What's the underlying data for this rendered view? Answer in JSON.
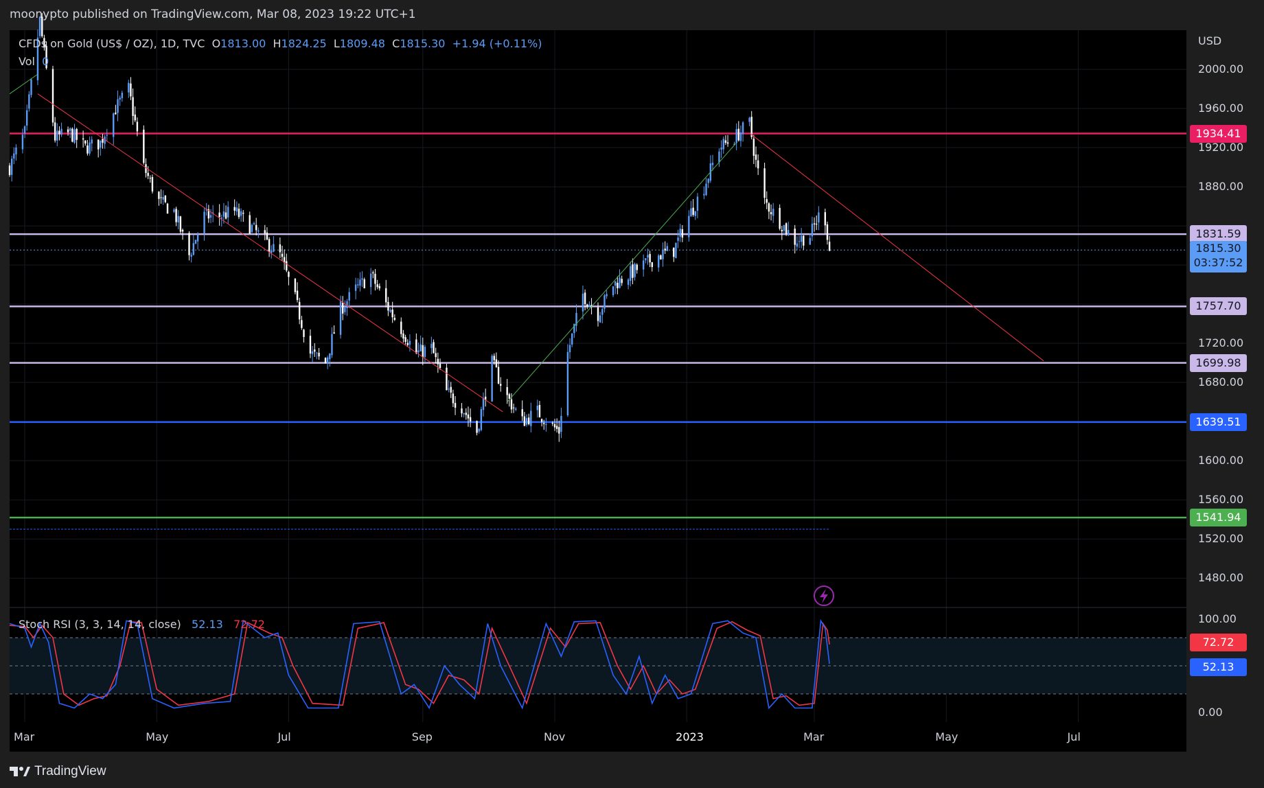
{
  "header": {
    "published_by": "moonypto published on TradingView.com, Mar 08, 2023 19:22 UTC+1"
  },
  "legend": {
    "symbol": "CFDs on Gold (US$ / OZ), 1D, TVC",
    "open_label": "O",
    "open": "1813.00",
    "high_label": "H",
    "high": "1824.25",
    "low_label": "L",
    "low": "1809.48",
    "close_label": "C",
    "close": "1815.30",
    "change": "+1.94 (+0.11%)",
    "vol_label": "Vol",
    "vol_value": "0"
  },
  "stoch_legend": {
    "label": "Stoch RSI (3, 3, 14, 14, close)",
    "k": "52.13",
    "d": "72.72"
  },
  "footer": {
    "brand": "TradingView"
  },
  "colors": {
    "background": "#000000",
    "frame": "#1e1e1e",
    "bull": "#5b9cf6",
    "bear": "#ffffff",
    "red_line": "#f23645",
    "resist_magenta": "#e91e63",
    "lavender": "#c9b8e8",
    "blue_support": "#2962ff",
    "green_support": "#4caf50",
    "stoch_k": "#2962ff",
    "stoch_d": "#f23645"
  },
  "chart_data": [
    {
      "type": "candlestick",
      "title": "CFDs on Gold (US$ / OZ), 1D, TVC",
      "currency": "USD",
      "ylim": [
        1450,
        2040
      ],
      "yticks": [
        2000,
        1960,
        1920,
        1880,
        1840,
        1800,
        1760,
        1720,
        1680,
        1640,
        1600,
        1560,
        1520,
        1480
      ],
      "ytick_labels": [
        "2000.00",
        "1960.00",
        "1920.00",
        "1880.00",
        "",
        "",
        "",
        "1720.00",
        "1680.00",
        "",
        "1600.00",
        "1560.00",
        "1520.00",
        "1480.00"
      ],
      "x_labels": [
        "Mar",
        "May",
        "Jul",
        "Sep",
        "Nov",
        "2023",
        "Mar",
        "May",
        "Jul"
      ],
      "x_label_dates": [
        "2022-03-01",
        "2022-05-01",
        "2022-07-01",
        "2022-09-01",
        "2022-11-01",
        "2023-01-01",
        "2023-03-01",
        "2023-05-01",
        "2023-07-01"
      ],
      "x_range": [
        "2022-02-22",
        "2023-08-20"
      ],
      "last_date": "2023-03-08",
      "close_path": [
        [
          "2022-02-22",
          1900
        ],
        [
          "2022-03-01",
          1935
        ],
        [
          "2022-03-08",
          2050
        ],
        [
          "2022-03-15",
          1930
        ],
        [
          "2022-03-22",
          1935
        ],
        [
          "2022-03-29",
          1920
        ],
        [
          "2022-04-05",
          1925
        ],
        [
          "2022-04-12",
          1960
        ],
        [
          "2022-04-18",
          1980
        ],
        [
          "2022-04-25",
          1900
        ],
        [
          "2022-05-02",
          1865
        ],
        [
          "2022-05-09",
          1855
        ],
        [
          "2022-05-16",
          1810
        ],
        [
          "2022-05-23",
          1850
        ],
        [
          "2022-05-30",
          1850
        ],
        [
          "2022-06-06",
          1855
        ],
        [
          "2022-06-13",
          1840
        ],
        [
          "2022-06-20",
          1825
        ],
        [
          "2022-06-27",
          1810
        ],
        [
          "2022-07-04",
          1765
        ],
        [
          "2022-07-11",
          1710
        ],
        [
          "2022-07-18",
          1700
        ],
        [
          "2022-07-25",
          1755
        ],
        [
          "2022-08-01",
          1775
        ],
        [
          "2022-08-08",
          1790
        ],
        [
          "2022-08-15",
          1760
        ],
        [
          "2022-08-22",
          1735
        ],
        [
          "2022-08-29",
          1710
        ],
        [
          "2022-09-05",
          1715
        ],
        [
          "2022-09-12",
          1670
        ],
        [
          "2022-09-19",
          1655
        ],
        [
          "2022-09-26",
          1630
        ],
        [
          "2022-10-03",
          1700
        ],
        [
          "2022-10-10",
          1665
        ],
        [
          "2022-10-17",
          1640
        ],
        [
          "2022-10-24",
          1650
        ],
        [
          "2022-10-31",
          1635
        ],
        [
          "2022-11-03",
          1630
        ],
        [
          "2022-11-07",
          1710
        ],
        [
          "2022-11-14",
          1770
        ],
        [
          "2022-11-21",
          1750
        ],
        [
          "2022-11-28",
          1780
        ],
        [
          "2022-12-05",
          1790
        ],
        [
          "2022-12-12",
          1800
        ],
        [
          "2022-12-19",
          1810
        ],
        [
          "2022-12-26",
          1815
        ],
        [
          "2023-01-02",
          1850
        ],
        [
          "2023-01-09",
          1880
        ],
        [
          "2023-01-16",
          1920
        ],
        [
          "2023-01-23",
          1930
        ],
        [
          "2023-01-30",
          1945
        ],
        [
          "2023-02-02",
          1905
        ],
        [
          "2023-02-06",
          1865
        ],
        [
          "2023-02-13",
          1845
        ],
        [
          "2023-02-20",
          1825
        ],
        [
          "2023-02-27",
          1830
        ],
        [
          "2023-03-03",
          1850
        ],
        [
          "2023-03-06",
          1847
        ],
        [
          "2023-03-08",
          1815.3
        ]
      ],
      "levels": [
        {
          "value": 1934.41,
          "label": "1934.41",
          "color": "#e91e63"
        },
        {
          "value": 1831.59,
          "label": "1831.59",
          "color": "#c9b8e8"
        },
        {
          "value": 1757.7,
          "label": "1757.70",
          "color": "#c9b8e8"
        },
        {
          "value": 1699.98,
          "label": "1699.98",
          "color": "#c9b8e8"
        },
        {
          "value": 1639.51,
          "label": "1639.51",
          "color": "#2962ff"
        },
        {
          "value": 1541.94,
          "label": "1541.94",
          "color": "#4caf50"
        }
      ],
      "last_price": {
        "value": 1815.3,
        "label": "1815.30",
        "countdown": "03:37:52",
        "color": "#5b9cf6"
      },
      "trendlines": [
        {
          "from": [
            "2022-03-07",
            1975
          ],
          "to": [
            "2022-10-08",
            1650
          ],
          "color": "#f23645"
        },
        {
          "from": [
            "2022-10-10",
            1660
          ],
          "to": [
            "2023-01-24",
            1925
          ],
          "color": "#4caf50"
        },
        {
          "from": [
            "2022-02-22",
            1975
          ],
          "to": [
            "2022-03-07",
            1995
          ],
          "color": "#4caf50"
        },
        {
          "from": [
            "2023-01-30",
            1935
          ],
          "to": [
            "2023-06-15",
            1702
          ],
          "color": "#f23645"
        }
      ]
    },
    {
      "type": "line",
      "title": "Stoch RSI (3, 3, 14, 14, close)",
      "ylim": [
        -10,
        110
      ],
      "yticks": [
        100,
        0
      ],
      "ytick_labels": [
        "100.00",
        "0.00"
      ],
      "bands": [
        80,
        50,
        20
      ],
      "series": [
        {
          "name": "K",
          "color": "#2962ff",
          "last": 52.13,
          "label": "52.13"
        },
        {
          "name": "D",
          "color": "#f23645",
          "last": 72.72,
          "label": "72.72"
        }
      ],
      "k_path": [
        [
          "2022-02-22",
          95
        ],
        [
          "2022-03-01",
          90
        ],
        [
          "2022-03-04",
          70
        ],
        [
          "2022-03-08",
          95
        ],
        [
          "2022-03-12",
          75
        ],
        [
          "2022-03-17",
          10
        ],
        [
          "2022-03-24",
          5
        ],
        [
          "2022-03-31",
          20
        ],
        [
          "2022-04-06",
          15
        ],
        [
          "2022-04-12",
          30
        ],
        [
          "2022-04-17",
          98
        ],
        [
          "2022-04-22",
          95
        ],
        [
          "2022-04-29",
          15
        ],
        [
          "2022-05-09",
          5
        ],
        [
          "2022-05-23",
          10
        ],
        [
          "2022-06-04",
          12
        ],
        [
          "2022-06-10",
          98
        ],
        [
          "2022-06-20",
          80
        ],
        [
          "2022-06-26",
          85
        ],
        [
          "2022-07-01",
          40
        ],
        [
          "2022-07-10",
          5
        ],
        [
          "2022-07-24",
          5
        ],
        [
          "2022-07-31",
          95
        ],
        [
          "2022-08-12",
          97
        ],
        [
          "2022-08-22",
          20
        ],
        [
          "2022-08-28",
          30
        ],
        [
          "2022-09-04",
          5
        ],
        [
          "2022-09-11",
          50
        ],
        [
          "2022-09-18",
          30
        ],
        [
          "2022-09-25",
          15
        ],
        [
          "2022-10-01",
          95
        ],
        [
          "2022-10-07",
          50
        ],
        [
          "2022-10-17",
          5
        ],
        [
          "2022-10-28",
          95
        ],
        [
          "2022-11-04",
          60
        ],
        [
          "2022-11-10",
          97
        ],
        [
          "2022-11-20",
          98
        ],
        [
          "2022-11-28",
          40
        ],
        [
          "2022-12-04",
          20
        ],
        [
          "2022-12-10",
          60
        ],
        [
          "2022-12-16",
          10
        ],
        [
          "2022-12-22",
          40
        ],
        [
          "2022-12-28",
          15
        ],
        [
          "2023-01-03",
          20
        ],
        [
          "2023-01-13",
          95
        ],
        [
          "2023-01-20",
          98
        ],
        [
          "2023-01-27",
          85
        ],
        [
          "2023-02-02",
          80
        ],
        [
          "2023-02-08",
          5
        ],
        [
          "2023-02-14",
          20
        ],
        [
          "2023-02-20",
          5
        ],
        [
          "2023-02-28",
          5
        ],
        [
          "2023-03-04",
          98
        ],
        [
          "2023-03-06",
          90
        ],
        [
          "2023-03-08",
          52.13
        ]
      ],
      "d_path": [
        [
          "2022-02-22",
          93
        ],
        [
          "2022-03-01",
          92
        ],
        [
          "2022-03-05",
          80
        ],
        [
          "2022-03-09",
          93
        ],
        [
          "2022-03-14",
          80
        ],
        [
          "2022-03-19",
          20
        ],
        [
          "2022-03-26",
          8
        ],
        [
          "2022-04-02",
          15
        ],
        [
          "2022-04-08",
          18
        ],
        [
          "2022-04-14",
          50
        ],
        [
          "2022-04-19",
          97
        ],
        [
          "2022-04-24",
          96
        ],
        [
          "2022-05-01",
          25
        ],
        [
          "2022-05-11",
          8
        ],
        [
          "2022-05-25",
          12
        ],
        [
          "2022-06-06",
          20
        ],
        [
          "2022-06-12",
          96
        ],
        [
          "2022-06-22",
          85
        ],
        [
          "2022-06-28",
          80
        ],
        [
          "2022-07-03",
          50
        ],
        [
          "2022-07-12",
          10
        ],
        [
          "2022-07-26",
          8
        ],
        [
          "2022-08-02",
          90
        ],
        [
          "2022-08-14",
          96
        ],
        [
          "2022-08-24",
          30
        ],
        [
          "2022-08-30",
          25
        ],
        [
          "2022-09-06",
          10
        ],
        [
          "2022-09-13",
          40
        ],
        [
          "2022-09-20",
          35
        ],
        [
          "2022-09-27",
          20
        ],
        [
          "2022-10-03",
          90
        ],
        [
          "2022-10-09",
          60
        ],
        [
          "2022-10-19",
          10
        ],
        [
          "2022-10-30",
          90
        ],
        [
          "2022-11-06",
          70
        ],
        [
          "2022-11-12",
          95
        ],
        [
          "2022-11-22",
          96
        ],
        [
          "2022-11-30",
          50
        ],
        [
          "2022-12-06",
          25
        ],
        [
          "2022-12-12",
          50
        ],
        [
          "2022-12-18",
          20
        ],
        [
          "2022-12-24",
          35
        ],
        [
          "2022-12-30",
          20
        ],
        [
          "2023-01-05",
          25
        ],
        [
          "2023-01-15",
          90
        ],
        [
          "2023-01-22",
          97
        ],
        [
          "2023-01-29",
          88
        ],
        [
          "2023-02-04",
          82
        ],
        [
          "2023-02-10",
          15
        ],
        [
          "2023-02-16",
          18
        ],
        [
          "2023-02-22",
          8
        ],
        [
          "2023-03-01",
          10
        ],
        [
          "2023-03-05",
          95
        ],
        [
          "2023-03-07",
          88
        ],
        [
          "2023-03-08",
          72.72
        ]
      ]
    }
  ]
}
